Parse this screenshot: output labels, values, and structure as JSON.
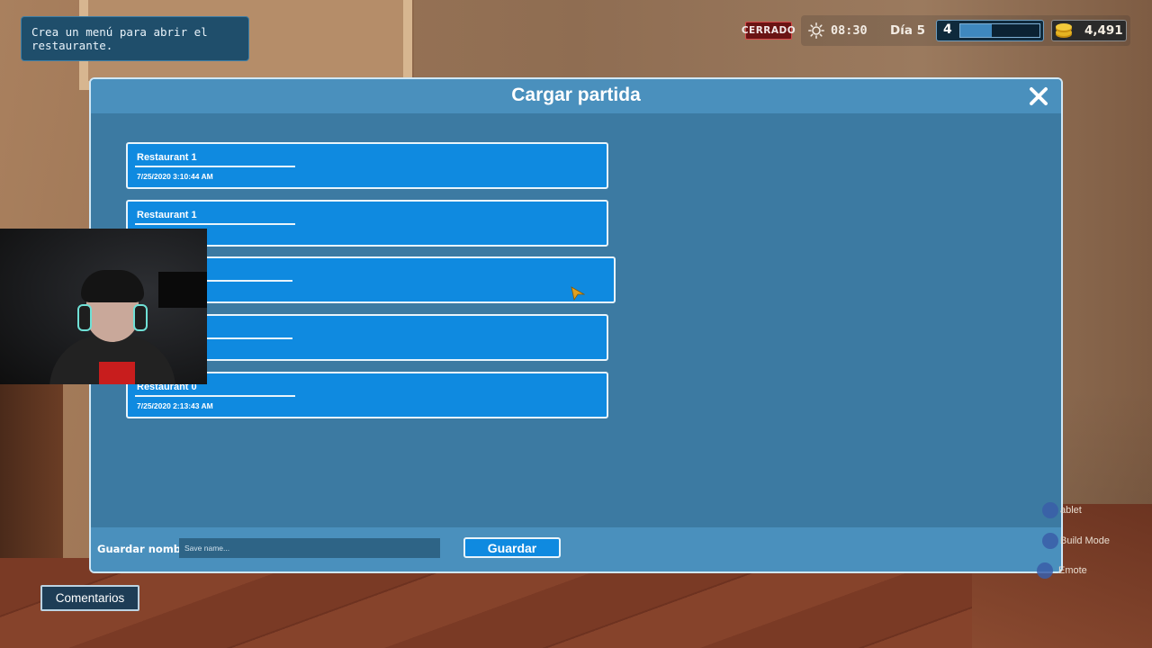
{
  "hud": {
    "objective": "Crea un menú para abrir el restaurante.",
    "status_badge": "CERRADO",
    "time": "08:30",
    "day": "Día 5",
    "level": "4",
    "xp_progress": 0.4,
    "coins": "4,491"
  },
  "dialog": {
    "title": "Cargar partida",
    "slots": [
      {
        "name": "Restaurant 1",
        "date": "7/25/2020 3:10:44 AM"
      },
      {
        "name": "Restaurant 1",
        "date": ""
      },
      {
        "name": "",
        "date": ""
      },
      {
        "name": "",
        "date": ""
      },
      {
        "name": "Restaurant 0",
        "date": "7/25/2020 2:13:43 AM"
      }
    ],
    "footer": {
      "save_name_label": "Guardar nombre:",
      "save_name_placeholder": "Save name...",
      "save_button": "Guardar"
    }
  },
  "side_hints": [
    {
      "label": "ablet"
    },
    {
      "label": "Build Mode"
    },
    {
      "label": "Emote"
    }
  ],
  "comments_button": "Comentarios",
  "colors": {
    "panel": "#3c7aa2",
    "header": "#4a90bd",
    "slot": "#0f8ae0",
    "closed_badge": "#6a1414"
  }
}
